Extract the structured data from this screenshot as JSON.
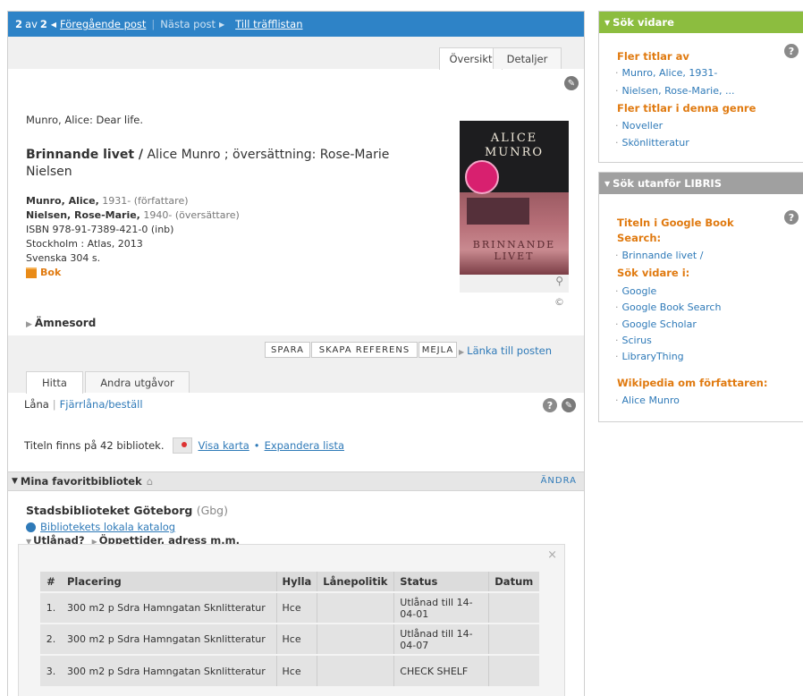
{
  "nav": {
    "pos": "2",
    "of": "av",
    "total": "2",
    "prev": "Föregående post",
    "next": "Nästa post",
    "list": "Till träfflistan"
  },
  "tabs": {
    "overview": "Översikt",
    "details": "Detaljer"
  },
  "record": {
    "author_title": "Munro, Alice: Dear life.",
    "title_bold": "Brinnande livet /",
    "title_rest": " Alice Munro ; översättning: Rose-Marie Nielsen",
    "author1_name": "Munro, Alice,",
    "author1_info": " 1931- (författare)",
    "author2_name": "Nielsen, Rose-Marie,",
    "author2_info": " 1940- (översättare)",
    "isbn": "ISBN 978-91-7389-421-0 (inb)",
    "pub": "Stockholm : Atlas, 2013",
    "lang": "Svenska 304 s.",
    "type": "Bok",
    "cover_top1": "ALICE",
    "cover_top2": "MUNRO",
    "cover_bottom1": "BRINNANDE",
    "cover_bottom2": "LIVET",
    "copyright": "©",
    "subjects": "Ämnesord"
  },
  "actions": {
    "spara": "SPARA",
    "skapa": "SKAPA REFERENS",
    "mejla": "MEJLA",
    "lanka": "Länka till posten"
  },
  "find_tabs": {
    "hitta": "Hitta",
    "andra": "Andra utgåvor"
  },
  "find": {
    "lana": "Låna",
    "fjarr": "Fjärrlåna/beställ",
    "count": "Titeln finns på 42 bibliotek.",
    "map": "Visa karta",
    "expand": "Expandera lista"
  },
  "fav": {
    "label": "Mina favoritbibliotek",
    "change": "ÄNDRA"
  },
  "library": {
    "name": "Stadsbiblioteket Göteborg",
    "code": "(Gbg)",
    "catalog": "Bibliotekets lokala katalog",
    "utlanad": "Utlånad?",
    "hours": "Öppettider, adress m.m."
  },
  "holdings": {
    "headers": [
      "#",
      "Placering",
      "Hylla",
      "Lånepolitik",
      "Status",
      "Datum"
    ],
    "rows": [
      {
        "n": "1.",
        "place": "300 m2 p Sdra Hamngatan Sknlitteratur",
        "shelf": "Hce",
        "policy": "",
        "status": "Utlånad till 14-04-01",
        "date": ""
      },
      {
        "n": "2.",
        "place": "300 m2 p Sdra Hamngatan Sknlitteratur",
        "shelf": "Hce",
        "policy": "",
        "status": "Utlånad till 14-04-07",
        "date": ""
      },
      {
        "n": "3.",
        "place": "300 m2 p Sdra Hamngatan Sknlitteratur",
        "shelf": "Hce",
        "policy": "",
        "status": "CHECK SHELF",
        "date": ""
      }
    ]
  },
  "side1": {
    "title": "Sök vidare",
    "h1": "Fler titlar av",
    "l1": "Munro, Alice, 1931-",
    "l2": "Nielsen, Rose-Marie, ...",
    "h2": "Fler titlar i denna genre",
    "l3": "Noveller",
    "l4": "Skönlitteratur"
  },
  "side2": {
    "title": "Sök utanför LIBRIS",
    "h1a": "Titeln i Google Book",
    "h1b": "Search:",
    "l1": "Brinnande livet /",
    "h2": "Sök vidare i:",
    "l2": "Google",
    "l3": "Google Book Search",
    "l4": "Google Scholar",
    "l5": "Scirus",
    "l6": "LibraryThing",
    "h3": "Wikipedia om författaren:",
    "l7": "Alice Munro"
  },
  "colors": {
    "nav_blue": "#2e83c7",
    "green": "#8cbd3f",
    "grey_head": "#a0a0a0",
    "orange": "#e07a10",
    "link": "#2f7ab8"
  }
}
